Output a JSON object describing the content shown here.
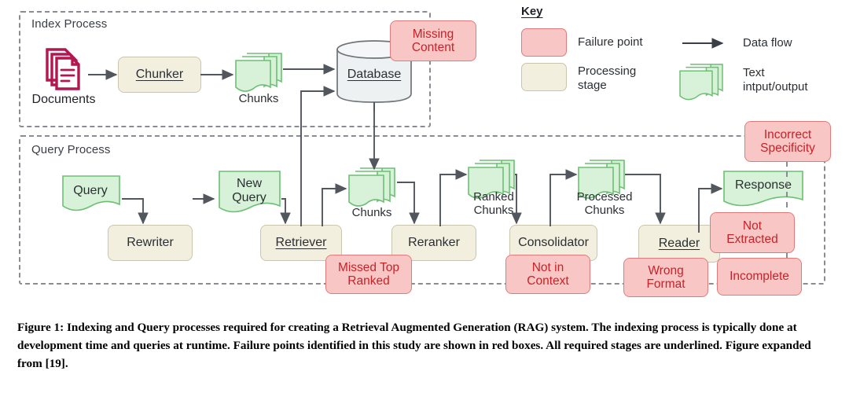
{
  "figure": {
    "groups": [
      {
        "id": "index-process",
        "label": "Index Process"
      },
      {
        "id": "query-process",
        "label": "Query Process"
      }
    ],
    "index_process": {
      "documents": {
        "label": "Documents",
        "icon": "documents-stack-icon",
        "color": "#b3174f"
      },
      "chunker": {
        "label": "Chunker",
        "required": true
      },
      "chunks": {
        "label": "Chunks",
        "icon": "text-stack-icon"
      },
      "database": {
        "label": "Database",
        "required": true,
        "icon": "database-cylinder-icon"
      },
      "missing_content": {
        "label": "Missing\nContent"
      }
    },
    "query_process": {
      "query": {
        "label": "Query",
        "icon": "text-doc-icon"
      },
      "rewriter": {
        "label": "Rewriter",
        "required": false
      },
      "new_query": {
        "label": "New\nQuery",
        "icon": "text-doc-icon"
      },
      "retriever": {
        "label": "Retriever",
        "required": true
      },
      "chunks": {
        "label": "Chunks",
        "icon": "text-stack-icon"
      },
      "reranker": {
        "label": "Reranker",
        "required": false
      },
      "ranked_chunks": {
        "label": "Ranked\nChunks",
        "icon": "text-stack-icon"
      },
      "consolidator": {
        "label": "Consolidator",
        "required": false
      },
      "processed_chunks": {
        "label": "Processed\nChunks",
        "icon": "text-stack-icon"
      },
      "reader": {
        "label": "Reader",
        "required": true
      },
      "response": {
        "label": "Response",
        "icon": "text-doc-icon"
      },
      "failures": [
        {
          "id": "missed-top-ranked",
          "label": "Missed Top\nRanked"
        },
        {
          "id": "not-in-context",
          "label": "Not in\nContext"
        },
        {
          "id": "wrong-format",
          "label": "Wrong\nFormat"
        },
        {
          "id": "not-extracted",
          "label": "Not\nExtracted"
        },
        {
          "id": "incomplete",
          "label": "Incomplete"
        },
        {
          "id": "incorrect-specificity",
          "label": "Incorrect\nSpecificity"
        }
      ]
    }
  },
  "key": {
    "title": "Key",
    "entries": [
      {
        "id": "failure-point",
        "label": "Failure point",
        "swatch": "red",
        "color": "#f9c6c6"
      },
      {
        "id": "processing-stage",
        "label": "Processing\nstage",
        "swatch": "beige",
        "color": "#f2efdf"
      },
      {
        "id": "data-flow",
        "label": "Data flow",
        "swatch": "arrow"
      },
      {
        "id": "text-io",
        "label": "Text\nintput/output",
        "swatch": "green-stack",
        "color": "#d7f2d8"
      }
    ]
  },
  "caption": {
    "text": "Figure 1: Indexing and Query processes required for creating a Retrieval Augmented Generation (RAG) system. The indexing process is typically done at development time and queries at runtime. Failure points identified in this study are shown in red boxes. All required stages are underlined. Figure expanded from [19]."
  },
  "colors": {
    "failure_fill": "#f9c6c6",
    "failure_stroke": "#e17b7b",
    "failure_text": "#c72227",
    "stage_fill": "#f2efdf",
    "stage_stroke": "#c9c5ae",
    "text_fill": "#d7f2d8",
    "text_stroke": "#6cbf73",
    "wire": "#52575d",
    "dashed_group": "#8b8b93",
    "documents_icon": "#b3174f",
    "db_fill": "#eef1f2"
  }
}
